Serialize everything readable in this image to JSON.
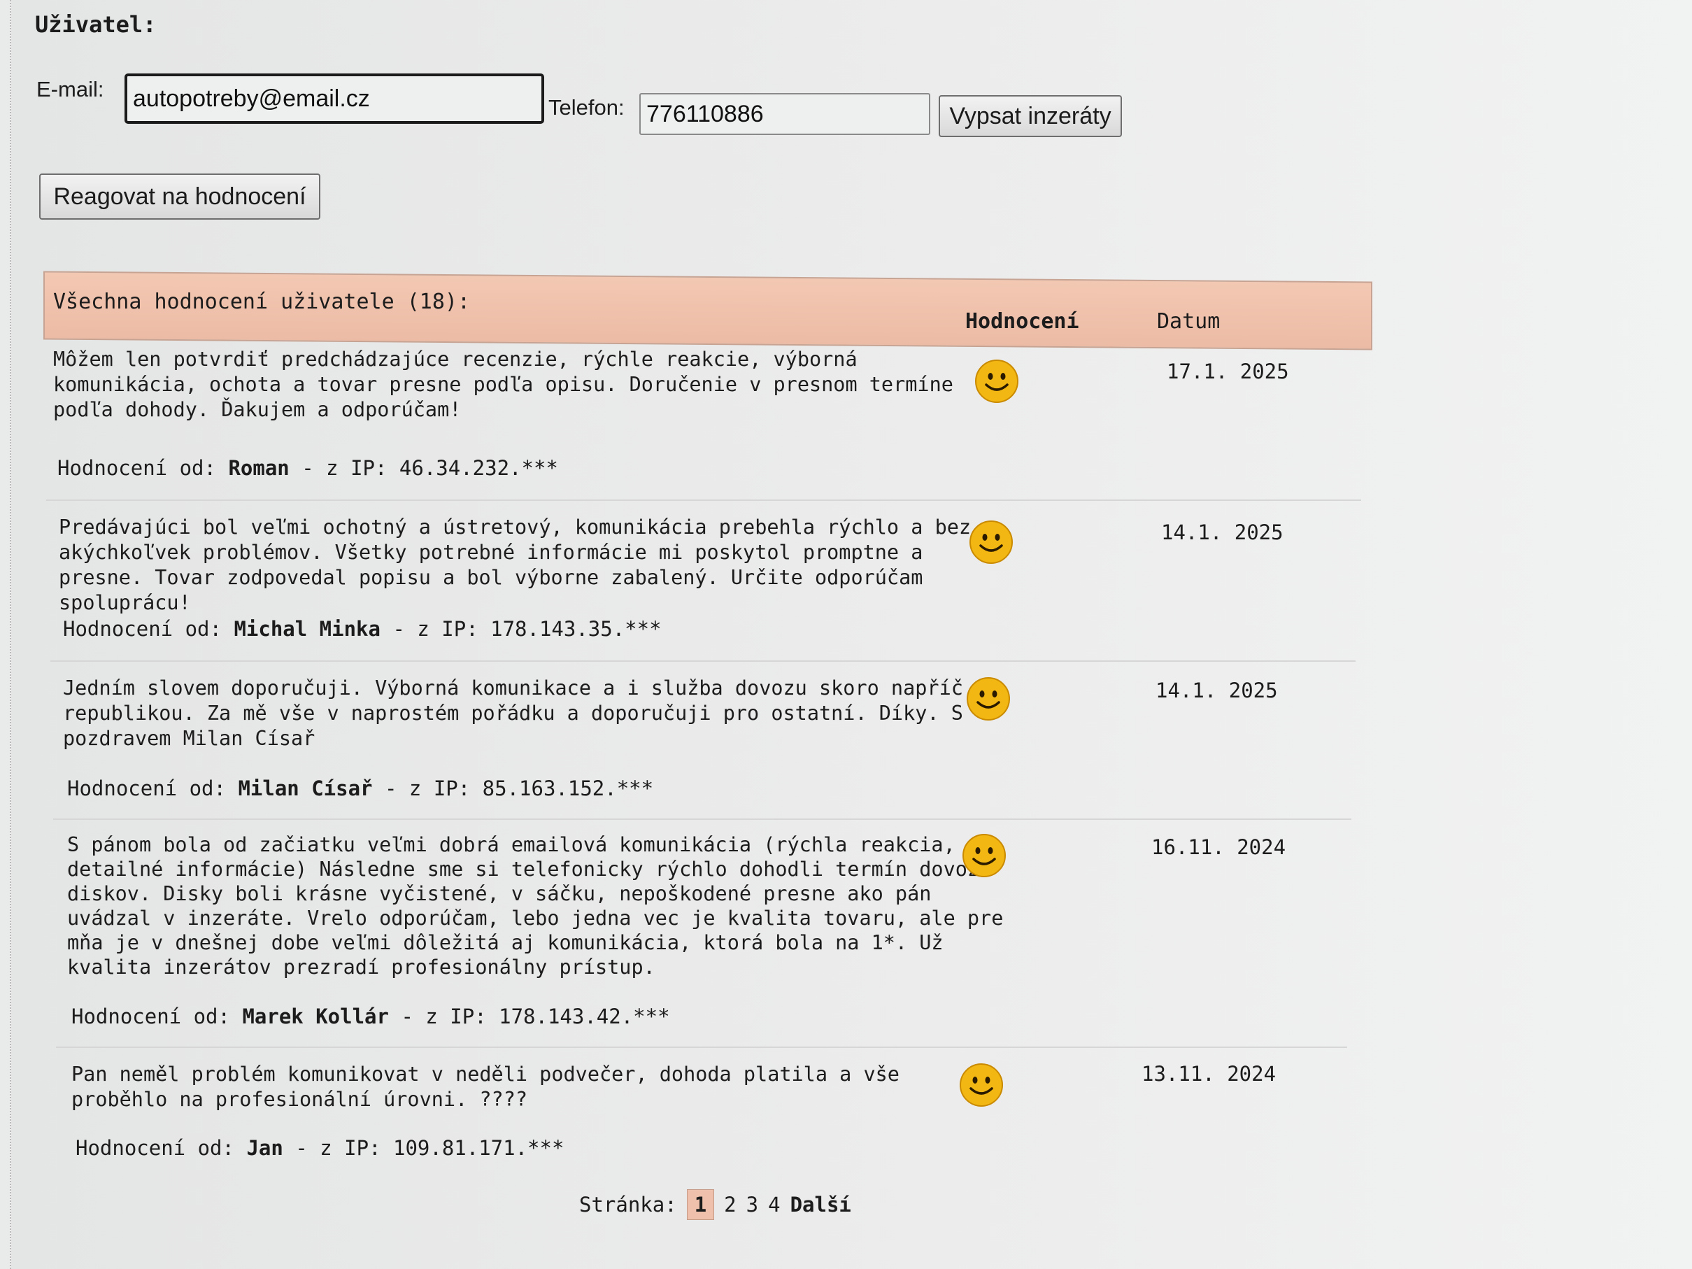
{
  "user": {
    "heading": "Uživatel:",
    "email_label": "E-mail:",
    "email_value": "autopotreby@email.cz",
    "phone_label": "Telefon:",
    "phone_value": "776110886",
    "list_button": "Vypsat inzeráty",
    "react_button": "Reagovat na hodnocení"
  },
  "ratings": {
    "title": "Všechna hodnocení uživatele (18):",
    "col_rating": "Hodnocení",
    "col_date": "Datum",
    "author_prefix": "Hodnocení od:",
    "ip_prefix": "- z IP:",
    "items": [
      {
        "text": "Môžem len potvrdiť predchádzajúce recenzie, rýchle reakcie, výborná komunikácia, ochota a tovar presne podľa opisu. Doručenie v presnom termíne podľa dohody. Ďakujem a odporúčam!",
        "author": "Roman",
        "ip": "46.34.232.***",
        "date": "17.1. 2025",
        "icon": "smiley-icon"
      },
      {
        "text": "Predávajúci bol veľmi ochotný a ústretový, komunikácia prebehla rýchlo a bez akýchkoľvek problémov. Všetky potrebné informácie mi poskytol promptne a presne. Tovar zodpovedal popisu a bol výborne zabalený. Určite odporúčam spoluprácu!",
        "author": "Michal Minka",
        "ip": "178.143.35.***",
        "date": "14.1. 2025",
        "icon": "smiley-icon"
      },
      {
        "text": "Jedním slovem doporučuji. Výborná komunikace a i služba dovozu skoro napříč republikou. Za mě vše v naprostém pořádku a doporučuji pro ostatní. Díky. S pozdravem Milan Císař",
        "author": "Milan Císař",
        "ip": "85.163.152.***",
        "date": "14.1. 2025",
        "icon": "smiley-icon"
      },
      {
        "text": "S pánom bola od začiatku veľmi dobrá emailová komunikácia (rýchla reakcia, detailné informácie) Následne sme si telefonicky rýchlo dohodli termín dovozu diskov. Disky boli krásne vyčistené, v sáčku, nepoškodené presne ako pán uvádzal v inzeráte. Vrelo odporúčam, lebo jedna vec je kvalita tovaru, ale pre mňa je v dnešnej dobe veľmi dôležitá aj komunikácia, ktorá bola na 1*. Už kvalita inzerátov prezradí profesionálny prístup.",
        "author": "Marek Kollár",
        "ip": "178.143.42.***",
        "date": "16.11. 2024",
        "icon": "smiley-icon"
      },
      {
        "text": "Pan neměl problém komunikovat v neděli podvečer, dohoda platila a vše proběhlo na profesionální úrovni. ????",
        "author": "Jan",
        "ip": "109.81.171.***",
        "date": "13.11. 2024",
        "icon": "smiley-icon"
      }
    ]
  },
  "pagination": {
    "label": "Stránka:",
    "pages": [
      "1",
      "2",
      "3",
      "4"
    ],
    "current": "1",
    "next": "Další"
  },
  "colors": {
    "header_bg": "#f0c2ad",
    "smiley_fill": "#f2b712",
    "smiley_outline": "#c98a00"
  }
}
